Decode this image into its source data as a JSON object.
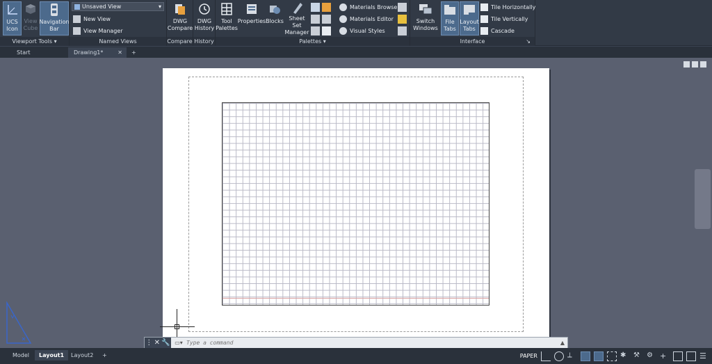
{
  "ribbon": {
    "viewport_tools": {
      "title": "Viewport Tools",
      "ucs_icon": [
        "UCS",
        "Icon"
      ],
      "view_cube": [
        "View",
        "Cube"
      ],
      "navigation_bar": [
        "Navigation",
        "Bar"
      ]
    },
    "named_views": {
      "title": "Named Views",
      "dropdown_value": "Unsaved View",
      "new_view": "New View",
      "view_manager": "View Manager"
    },
    "compare": {
      "title": "Compare",
      "dwg_compare": [
        "DWG",
        "Compare"
      ]
    },
    "history": {
      "title": "History",
      "dwg_history": [
        "DWG",
        "History"
      ]
    },
    "palettes": {
      "title": "Palettes",
      "tool_palettes": [
        "Tool",
        "Palettes"
      ],
      "properties": "Properties",
      "blocks": "Blocks",
      "sheet_set_manager": [
        "Sheet Set",
        "Manager"
      ],
      "materials_browser": "Materials Browser",
      "materials_editor": "Materials Editor",
      "visual_styles": "Visual Styles"
    },
    "interface": {
      "title": "Interface",
      "switch_windows": [
        "Switch",
        "Windows"
      ],
      "file_tabs": [
        "File",
        "Tabs"
      ],
      "layout_tabs": [
        "Layout",
        "Tabs"
      ],
      "tile_horizontally": "Tile Horizontally",
      "tile_vertically": "Tile Vertically",
      "cascade": "Cascade"
    }
  },
  "file_tabs": {
    "start": "Start",
    "drawing": "Drawing1*",
    "close": "✕",
    "add": "+"
  },
  "command_line": {
    "placeholder": "Type a command"
  },
  "status_bar": {
    "layout_tabs": [
      "Model",
      "Layout1",
      "Layout2"
    ],
    "add_tab": "+",
    "space_label": "PAPER"
  },
  "colors": {
    "ribbon_bg": "#323a46",
    "active_toggle": "#4c6a8c",
    "viewport_bg": "#5a6070",
    "ucs_blue": "#3a66c9"
  }
}
